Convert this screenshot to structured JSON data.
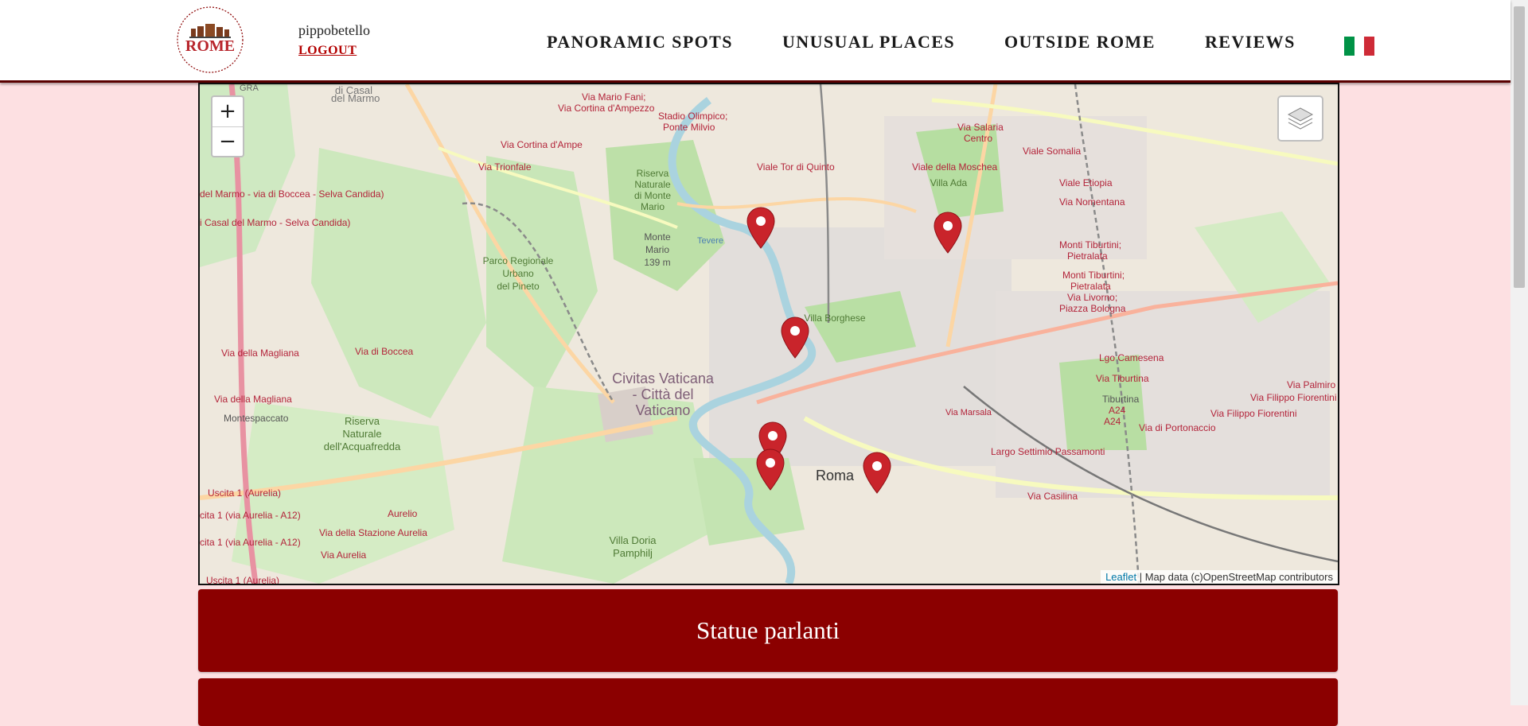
{
  "header": {
    "logo_alt": "ROME logo",
    "username": "pippobetello",
    "logout_label": "LOGOUT",
    "nav": [
      {
        "label": "PANORAMIC SPOTS"
      },
      {
        "label": "UNUSUAL PLACES"
      },
      {
        "label": "OUTSIDE ROME"
      },
      {
        "label": "REVIEWS"
      }
    ],
    "language_flag": "italian-flag",
    "flag_colors": [
      "#009246",
      "#ffffff",
      "#ce2b37"
    ]
  },
  "map": {
    "zoom_in_label": "+",
    "zoom_out_label": "−",
    "layers_icon": "layers-icon",
    "attribution_link": "Leaflet",
    "attribution_text": " | Map data (c)OpenStreetMap contributors",
    "labels": {
      "vatican_1": "Civitas Vaticana",
      "vatican_2": "- Città del",
      "vatican_3": "Vaticano",
      "roma": "Roma",
      "villa_borghese": "Villa Borghese",
      "villa_ada": "Villa Ada",
      "monte_mario_1": "Monte",
      "monte_mario_2": "Mario",
      "monte_mario_3": "139 m",
      "riserva_1": "Riserva",
      "riserva_2": "Naturale",
      "riserva_3": "dell'Acquafredda",
      "villa_doria_1": "Villa Doria",
      "villa_doria_2": "Pamphilj",
      "parco_1": "Parco Regionale",
      "parco_2": "Urbano",
      "parco_3": "del Pineto",
      "riserva_mm_1": "Riserva",
      "riserva_mm_2": "Naturale",
      "riserva_mm_3": "di Monte",
      "riserva_mm_4": "Mario",
      "casal_marmo_1": "di Casal",
      "casal_marmo_2": "del Marmo",
      "via_fani_1": "Via Mario Fani;",
      "via_fani_2": "Via Cortina d'Ampezzo",
      "stadio_1": "Stadio Olimpico;",
      "stadio_2": "Ponte Milvio",
      "viale_tor": "Viale Tor di Quinto",
      "viale_moschea": "Viale della Moschea",
      "via_salaria_1": "Via Salaria",
      "via_salaria_2": "Centro",
      "viale_somalia": "Viale Somalia",
      "viale_etiopia": "Viale Etiopia",
      "via_nomentana": "Via Nomentana",
      "monti_tib_1": "Monti Tiburtini;",
      "monti_tib_2": "Pietralata",
      "monti_tib_3": "Monti Tiburtini;",
      "monti_tib_4": "Pietralata",
      "via_livorno": "Via Livorno;",
      "piazza_bologna": "Piazza Bologna",
      "lgo_camesena": "Lgo Camesena",
      "via_tiburtina": "Via Tiburtina",
      "tiburtina_a24_1": "Tiburtina",
      "tiburtina_a24_2": "A24",
      "tiburtina_a24_3": "A24",
      "via_portonaccio": "Via di Portonaccio",
      "via_palmiro": "Via Palmiro",
      "via_filippo_1": "Via Filippo Fiorentini",
      "via_filippo_2": "Via Filippo Fiorentini",
      "largo_settimio": "Largo Settimio Passamonti",
      "via_casilina": "Via Casilina",
      "via_cortina": "Via Cortina d'Ampe",
      "via_trionfale": "Via Trionfale",
      "via_boccea_marmo": "del Marmo - via di Boccea - Selva Candida)",
      "casal_selva": "i Casal del Marmo - Selva Candida)",
      "via_magliana_1": "Via della Magliana",
      "via_magliana_2": "Via della Magliana",
      "montespaccato": "Montespaccato",
      "via_boccea": "Via di Boccea",
      "uscita_1": "Uscita 1 (Aurelia)",
      "uscita_2": "cita 1 (via Aurelia - A12)",
      "uscita_3": "cita 1 (via Aurelia - A12)",
      "uscita_4": "Uscita 1 (Aurelia)",
      "aurelio": "Aurelio",
      "via_stazione": "Via della Stazione Aurelia",
      "via_aurelia": "Via Aurelia",
      "gra": "GRA",
      "via_marsala": "Via Marsala",
      "tevere": "Tevere"
    },
    "markers": [
      {
        "name": "marker-1"
      },
      {
        "name": "marker-2"
      },
      {
        "name": "marker-3"
      },
      {
        "name": "marker-4"
      },
      {
        "name": "marker-5"
      },
      {
        "name": "marker-6"
      }
    ],
    "marker_color": "#c9242b"
  },
  "cards": [
    {
      "title": "Statue parlanti"
    },
    {
      "title": ""
    }
  ],
  "colors": {
    "accent": "#8b0000",
    "page_bg": "#fde0e2",
    "logout": "#b30000"
  }
}
